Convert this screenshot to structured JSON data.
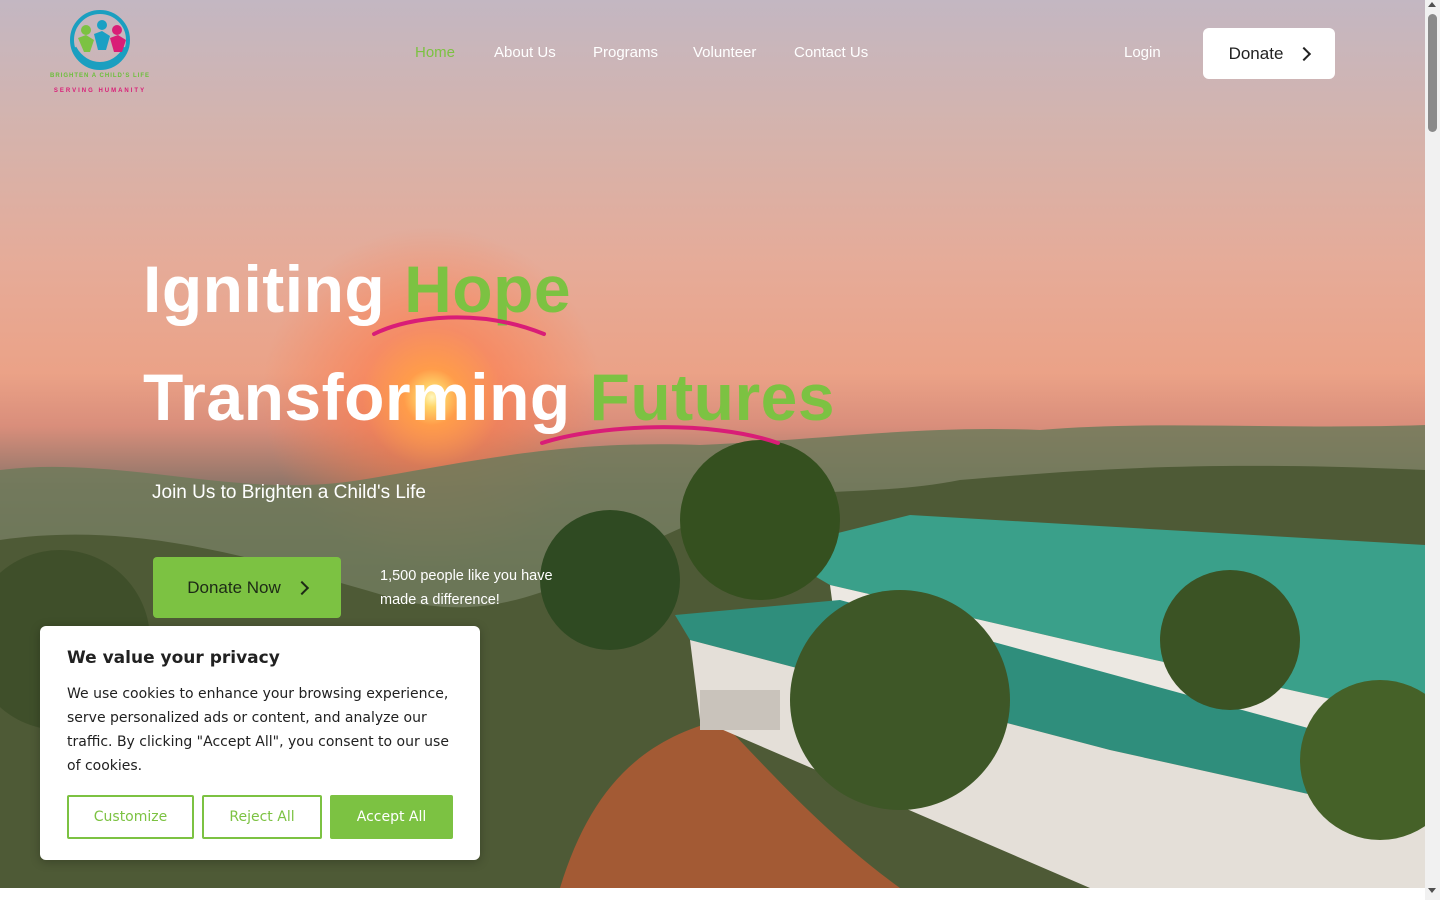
{
  "logo": {
    "tagline_top": "BRIGHTEN A CHILD'S LIFE",
    "tagline_bottom": "SERVING HUMANITY"
  },
  "nav": {
    "items": [
      {
        "label": "Home",
        "active": true
      },
      {
        "label": "About Us",
        "active": false
      },
      {
        "label": "Programs",
        "active": false
      },
      {
        "label": "Volunteer",
        "active": false
      },
      {
        "label": "Contact Us",
        "active": false
      }
    ],
    "login_label": "Login",
    "donate_label": "Donate"
  },
  "hero": {
    "line1_white": "Igniting",
    "line1_green": "Hope",
    "line2_white": "Transforming",
    "line2_green": "Futures",
    "subtitle": "Join Us to Brighten a Child's Life",
    "cta_label": "Donate Now",
    "impact_text": "1,500 people like you have made a difference!"
  },
  "cookie_banner": {
    "title": "We value your privacy",
    "body": "We use cookies to enhance your browsing experience, serve personalized ads or content, and analyze our traffic. By clicking \"Accept All\", you consent to our use of cookies.",
    "customize_label": "Customize",
    "reject_label": "Reject All",
    "accept_label": "Accept All"
  },
  "colors": {
    "accent_green": "#7cc242",
    "accent_pink": "#d91d77",
    "white": "#ffffff"
  }
}
